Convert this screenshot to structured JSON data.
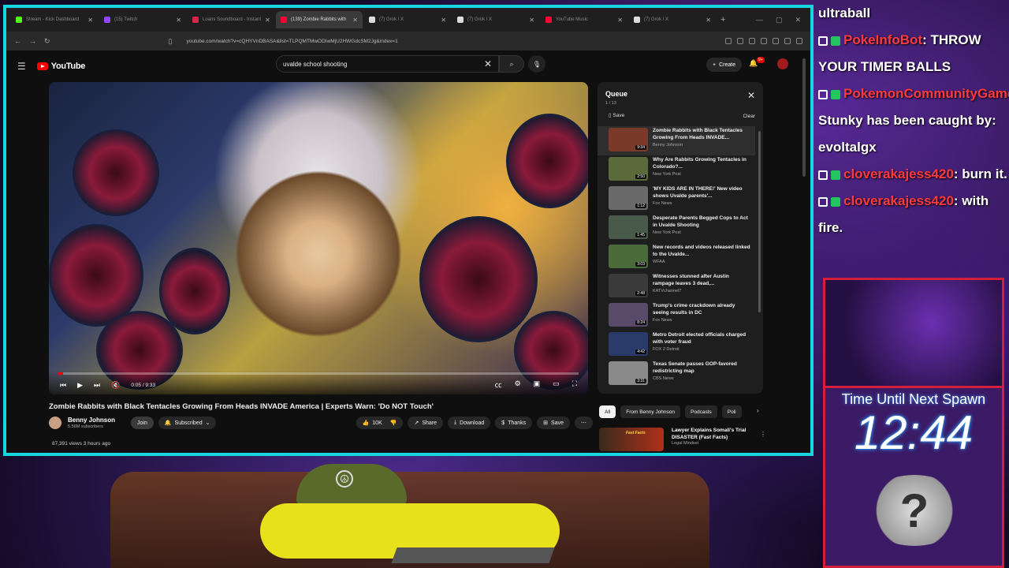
{
  "browser": {
    "tabs": [
      {
        "label": "Stream - Kick Dashboard",
        "color": "#53fc18",
        "active": false
      },
      {
        "label": "(15) Twitch",
        "color": "#9146ff",
        "active": false
      },
      {
        "label": "Loans Soundboard - Instant",
        "color": "#d9264a",
        "active": false
      },
      {
        "label": "(139) Zombie Rabbits with",
        "color": "#ff0033",
        "active": true
      },
      {
        "label": "(7) Grok / X",
        "color": "#dddddd",
        "active": false
      },
      {
        "label": "(7) Grok / X",
        "color": "#dddddd",
        "active": false
      },
      {
        "label": "YouTube Music",
        "color": "#ff0033",
        "active": false
      },
      {
        "label": "(7) Grok / X",
        "color": "#dddddd",
        "active": false
      }
    ],
    "url": "youtube.com/watch?v=cQHYVnDBASA&list=TLPQMTMwODIwMjU2HWGdcSM2Jg&index=1"
  },
  "youtube": {
    "logo_text": "YouTube",
    "search": {
      "value": "uvalde school shooting"
    },
    "create_label": "Create",
    "notifications_badge": "9+",
    "player": {
      "time": "0:05 / 9:33",
      "progress": 0.009
    },
    "video": {
      "title": "Zombie Rabbits with Black Tentacles Growing From Heads INVADE America | Experts Warn: 'Do NOT Touch'",
      "channel": "Benny Johnson",
      "subscribers": "5.56M subscribers",
      "join_label": "Join",
      "subscribed_label": "Subscribed",
      "likes": "10K",
      "share_label": "Share",
      "download_label": "Download",
      "thanks_label": "Thanks",
      "save_label": "Save",
      "views": "87,391 views  3 hours ago"
    },
    "queue": {
      "title": "Queue",
      "count": "1 / 13",
      "save_label": "Save",
      "clear_label": "Clear",
      "items": [
        {
          "title": "Zombie Rabbits with Black Tentacles Growing From Heads INVADE...",
          "channel": "Benny Johnson",
          "duration": "9:34",
          "color": "#7a3a2a"
        },
        {
          "title": "Why Are Rabbits Growing Tentacles in Colorado?...",
          "channel": "New York Post",
          "duration": "2:50",
          "color": "#5a6a3a"
        },
        {
          "title": "'MY KIDS ARE IN THERE!' New video shows Uvalde parents'...",
          "channel": "Fox News",
          "duration": "1:12",
          "color": "#6a6a6a"
        },
        {
          "title": "Desperate Parents Begged Cops to Act in Uvalde Shooting",
          "channel": "New York Post",
          "duration": "1:45",
          "color": "#4a5a4a"
        },
        {
          "title": "New records and videos released linked to the Uvalde...",
          "channel": "WFAA",
          "duration": "3:03",
          "color": "#4a6a3a"
        },
        {
          "title": "Witnesses stunned after Austin rampage leaves 3 dead,...",
          "channel": "KATVchannel7",
          "duration": "2:48",
          "color": "#3a3a3a"
        },
        {
          "title": "Trump's crime crackdown already seeing results in DC",
          "channel": "Fox News",
          "duration": "8:24",
          "color": "#5a4a6a"
        },
        {
          "title": "Metro Detroit elected officials charged with voter fraud",
          "channel": "FOX 2 Detroit",
          "duration": "4:42",
          "color": "#2a3a6a"
        },
        {
          "title": "Texas Senate passes GOP-favored redistricting map",
          "channel": "CBS News",
          "duration": "3:31",
          "color": "#8a8a8a"
        }
      ]
    },
    "chips": [
      "All",
      "From Benny Johnson",
      "Podcasts",
      "Poli"
    ],
    "related": {
      "tag": "Fast Facts",
      "title": "Lawyer Explains Somali's Trial DISASTER (Fast Facts)",
      "channel": "Legal Mindset"
    }
  },
  "chat": {
    "messages": [
      {
        "user": "",
        "text": "ultraball"
      },
      {
        "user": "PokeInfoBot",
        "text": ": THROW"
      },
      {
        "user": "",
        "text": "YOUR TIMER BALLS"
      },
      {
        "user": "PokemonCommunityGame",
        "text": ":"
      },
      {
        "user": "",
        "text": "Stunky has been caught by:"
      },
      {
        "user": "",
        "text": "evoltalgx"
      },
      {
        "user": "cloverakajess420",
        "text": ": burn it."
      },
      {
        "user": "cloverakajess420",
        "text": ": with"
      },
      {
        "user": "",
        "text": "fire."
      }
    ]
  },
  "spawn": {
    "label": "Time Until Next Spawn",
    "time": "12:44",
    "mystery": "?"
  }
}
